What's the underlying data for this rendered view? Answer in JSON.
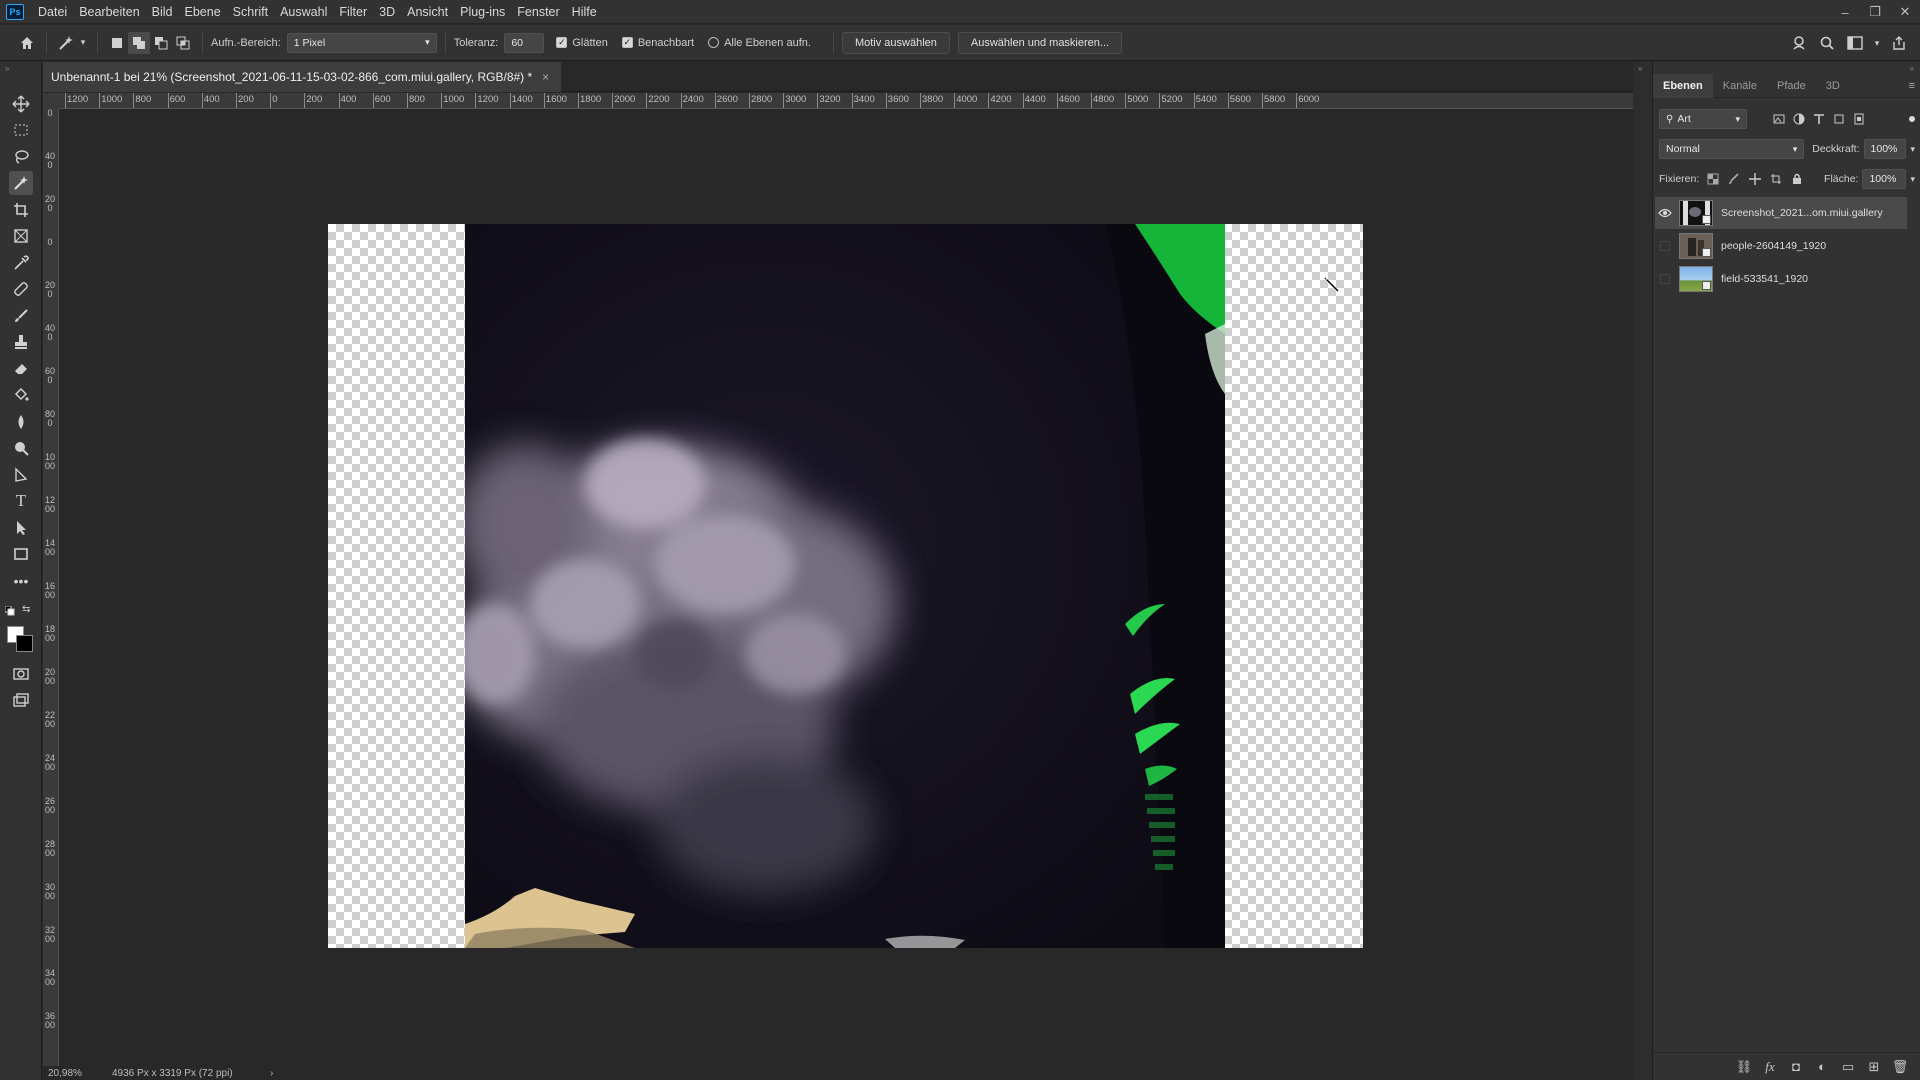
{
  "app": {
    "logo_text": "Ps"
  },
  "menu": {
    "items": [
      "Datei",
      "Bearbeiten",
      "Bild",
      "Ebene",
      "Schrift",
      "Auswahl",
      "Filter",
      "3D",
      "Ansicht",
      "Plug-ins",
      "Fenster",
      "Hilfe"
    ]
  },
  "window_controls": {
    "minimize": "–",
    "restore": "❐",
    "close": "✕"
  },
  "options": {
    "sample_size_label": "Aufn.-Bereich:",
    "sample_size_value": "1 Pixel",
    "tolerance_label": "Toleranz:",
    "tolerance_value": "60",
    "anti_alias_label": "Glätten",
    "contiguous_label": "Benachbart",
    "all_layers_label": "Alle Ebenen aufn.",
    "select_subject_button": "Motiv auswählen",
    "select_mask_button": "Auswählen und maskieren..."
  },
  "document": {
    "tab_title": "Unbenannt-1 bei 21% (Screenshot_2021-06-11-15-03-02-866_com.miui.gallery, RGB/8#) *",
    "close": "×"
  },
  "ruler": {
    "h_labels": [
      "1200",
      "1000",
      "800",
      "600",
      "400",
      "200",
      "0",
      "200",
      "400",
      "600",
      "800",
      "1000",
      "1200",
      "1400",
      "1600",
      "1800",
      "2000",
      "2200",
      "2400",
      "2600",
      "2800",
      "3000",
      "3200",
      "3400",
      "3600",
      "3800",
      "4000",
      "4200",
      "4400",
      "4600",
      "4800",
      "5000",
      "5200",
      "5400",
      "5600",
      "5800",
      "6000"
    ],
    "v_labels": [
      "0",
      "400",
      "200",
      "0",
      "200",
      "400",
      "600",
      "800",
      "1000",
      "1200",
      "1400",
      "1600",
      "1800",
      "2000",
      "2200",
      "2400",
      "2600",
      "2800",
      "3000",
      "3200",
      "3400",
      "3600"
    ]
  },
  "status": {
    "zoom": "20,98%",
    "doc_info": "4936 Px x 3319 Px (72 ppi)",
    "arrow": "›"
  },
  "panel": {
    "tabs": [
      "Ebenen",
      "Kanäle",
      "Pfade",
      "3D"
    ],
    "filter_label": "Art",
    "blend_mode": "Normal",
    "opacity_label": "Deckkraft:",
    "opacity_value": "100%",
    "lock_label": "Fixieren:",
    "fill_label": "Fläche:",
    "fill_value": "100%",
    "layers": [
      {
        "name": "Screenshot_2021...om.miui.gallery",
        "visible": true,
        "selected": true
      },
      {
        "name": "people-2604149_1920",
        "visible": false,
        "selected": false
      },
      {
        "name": "field-533541_1920",
        "visible": false,
        "selected": false
      }
    ]
  }
}
